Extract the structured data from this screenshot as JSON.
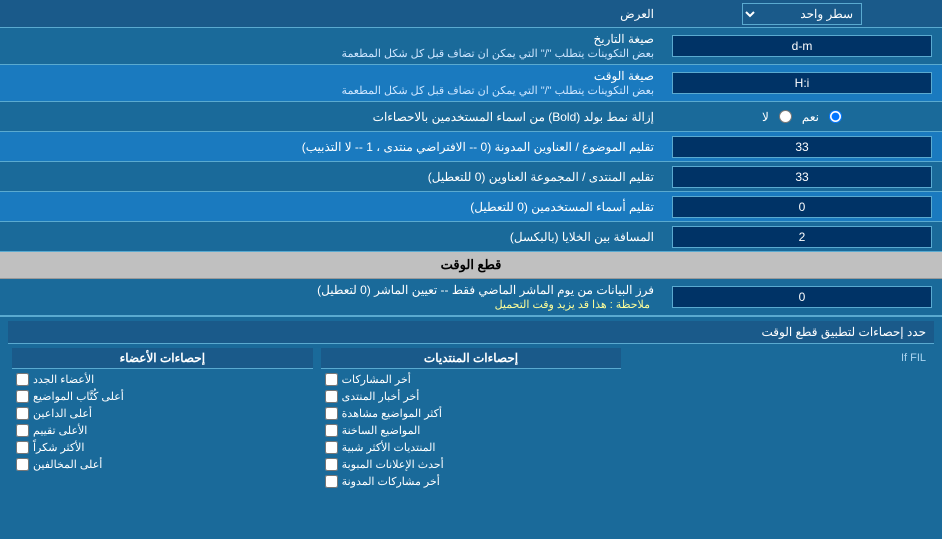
{
  "page": {
    "title": "العرض",
    "dropdown_label": "سطر واحد",
    "sections": [
      {
        "label": "صيغة التاريخ",
        "sublabel": "بعض التكوينات يتطلب \"/\" التي يمكن ان تضاف قبل كل شكل المطعمة",
        "input_value": "d-m",
        "type": "text"
      },
      {
        "label": "صيغة الوقت",
        "sublabel": "بعض التكوينات يتطلب \"/\" التي يمكن ان تضاف قبل كل شكل المطعمة",
        "input_value": "H:i",
        "type": "text"
      },
      {
        "label": "إزالة نمط بولد (Bold) من اسماء المستخدمين بالاحصاءات",
        "radio_option1": "نعم",
        "radio_option2": "لا",
        "radio_selected": "نعم",
        "type": "radio"
      },
      {
        "label": "تقليم الموضوع / العناوين المدونة (0 -- الافتراضي منتدى ، 1 -- لا التذبيب)",
        "input_value": "33",
        "type": "text"
      },
      {
        "label": "تقليم المنتدى / المجموعة العناوين (0 للتعطيل)",
        "input_value": "33",
        "type": "text"
      },
      {
        "label": "تقليم أسماء المستخدمين (0 للتعطيل)",
        "input_value": "0",
        "type": "text"
      },
      {
        "label": "المسافة بين الخلايا (بالبكسل)",
        "input_value": "2",
        "type": "text"
      }
    ],
    "section_header": "قطع الوقت",
    "cutoff_label": "فرز البيانات من يوم الماشر الماضي فقط -- تعيين الماشر (0 لتعطيل)",
    "cutoff_note": "ملاحظة : هذا قد يزيد وقت التحميل",
    "cutoff_value": "0",
    "stats_label": "حدد إحصاءات لتطبيق قطع الوقت",
    "col1_header": "إحصاءات الأعضاء",
    "col2_header": "إحصاءات المنتديات",
    "col1_items": [
      "الأعضاء الجدد",
      "أعلى كُتَّاب المواضيع",
      "أعلى الداعين",
      "الأعلى تقييم",
      "الأكثر شكراً",
      "أعلى المخالفين"
    ],
    "col2_items": [
      "أخر المشاركات",
      "أخر أخبار المنتدى",
      "أكثر المواضيع مشاهدة",
      "المواضيع الساخنة",
      "المنتديات الأكثر شبية",
      "أحدث الإعلانات المبوبة",
      "أخر مشاركات المدونة"
    ]
  }
}
